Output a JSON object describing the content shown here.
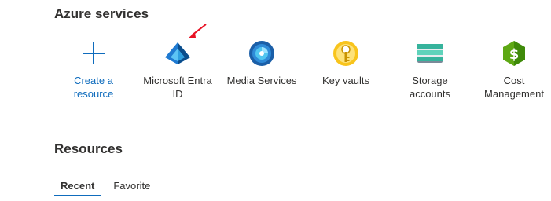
{
  "azure_services": {
    "title": "Azure services",
    "tiles": [
      {
        "label": "Create a resource",
        "icon": "plus-icon"
      },
      {
        "label": "Microsoft Entra ID",
        "icon": "entra-id-icon"
      },
      {
        "label": "Media Services",
        "icon": "media-services-icon"
      },
      {
        "label": "Key vaults",
        "icon": "key-vault-icon"
      },
      {
        "label": "Storage accounts",
        "icon": "storage-accounts-icon"
      },
      {
        "label": "Cost Management",
        "icon": "cost-management-icon"
      }
    ]
  },
  "resources": {
    "title": "Resources",
    "tabs": [
      {
        "label": "Recent",
        "active": true
      },
      {
        "label": "Favorite",
        "active": false
      }
    ]
  },
  "colors": {
    "accent": "#0f6cbd",
    "annotation_arrow": "#e81123"
  }
}
